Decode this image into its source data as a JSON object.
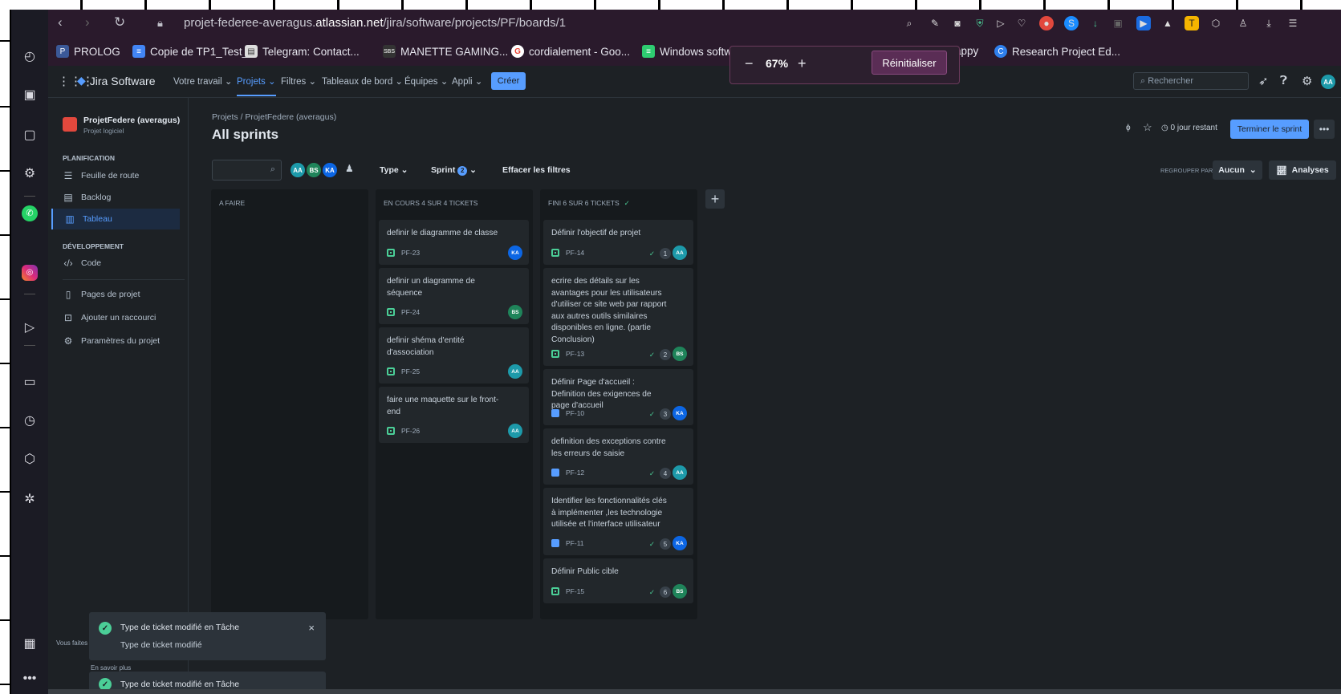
{
  "browser": {
    "url_prefix": "projet-federee-averagus.",
    "url_domain": "atlassian.net",
    "url_path": "/jira/software/projects/PF/boards/1",
    "bookmarks": [
      {
        "label": "PROLOG",
        "icon": "prolog-icon",
        "color": "#3b5998"
      },
      {
        "label": "Copie de TP1_Test_...",
        "icon": "docs-icon",
        "color": "#4285f4"
      },
      {
        "label": "Telegram: Contact...",
        "icon": "file-icon",
        "color": "#dddddd"
      },
      {
        "label": "MANETTE GAMING...",
        "icon": "sbs-icon",
        "color": "#333333"
      },
      {
        "label": "cordialement - Goo...",
        "icon": "google-icon",
        "color": "#ffffff"
      },
      {
        "label": "Windows softw",
        "icon": "windows-icon",
        "color": "#2ecc71"
      },
      {
        "label": "appy",
        "icon": "appy-icon",
        "color": "#2a1a2c"
      },
      {
        "label": "Research Project Ed...",
        "icon": "research-icon",
        "color": "#2f80ed"
      }
    ],
    "zoom": {
      "value": "67%",
      "minus": "−",
      "plus": "+",
      "reset": "Réinitialiser"
    }
  },
  "jira": {
    "product": "Jira Software",
    "nav": [
      "Votre travail",
      "Projets",
      "Filtres",
      "Tableaux de bord",
      "Équipes",
      "Appli"
    ],
    "create": "Créer",
    "search_placeholder": "Rechercher",
    "user_initials": "AA"
  },
  "sidebar": {
    "project_name": "ProjetFedere (averagus)",
    "project_type": "Projet logiciel",
    "planning_header": "PLANIFICATION",
    "planning_items": [
      "Feuille de route",
      "Backlog",
      "Tableau"
    ],
    "dev_header": "DÉVELOPPEMENT",
    "dev_items": [
      "Code"
    ],
    "other_items": [
      "Pages de projet",
      "Ajouter un raccourci",
      "Paramètres du projet"
    ]
  },
  "board": {
    "breadcrumb": "Projets  /  ProjetFedere (averagus)",
    "title": "All sprints",
    "days_left": "0 jour restant",
    "end_sprint": "Terminer le sprint",
    "more": "•••",
    "filters": {
      "avatars": [
        {
          "initials": "AA",
          "color": "#1d9aaa"
        },
        {
          "initials": "BS",
          "color": "#1f845a"
        },
        {
          "initials": "KA",
          "color": "#0c66e4"
        }
      ],
      "type": "Type",
      "sprint": "Sprint",
      "sprint_count": "2",
      "clear": "Effacer les filtres",
      "group_by_label": "REGROUPER PAR",
      "group_by_value": "Aucun",
      "insights": "Analyses"
    },
    "columns": [
      {
        "title": "A FAIRE",
        "done": false,
        "cards": []
      },
      {
        "title": "EN COURS 4 SUR 4 TICKETS",
        "done": false,
        "cards": [
          {
            "title": "definir le diagramme de classe",
            "key": "PF-23",
            "type": "story",
            "assignee": "KA",
            "color": "#0c66e4"
          },
          {
            "title": "definir un diagramme de séquence",
            "key": "PF-24",
            "type": "story",
            "assignee": "BS",
            "color": "#1f845a"
          },
          {
            "title": "definir shéma d'entité d'association",
            "key": "PF-25",
            "type": "story",
            "assignee": "AA",
            "color": "#1d9aaa"
          },
          {
            "title": "faire une maquette sur le front-end",
            "key": "PF-26",
            "type": "story",
            "assignee": "AA",
            "color": "#1d9aaa"
          }
        ]
      },
      {
        "title": "FINI 6 SUR 6 TICKETS",
        "done": true,
        "cards": [
          {
            "title": "Définir l'objectif de projet",
            "key": "PF-14",
            "type": "story",
            "num": "1",
            "assignee": "AA",
            "color": "#1d9aaa"
          },
          {
            "title": "ecrire des détails sur les avantages pour les utilisateurs d'utiliser ce site web par rapport aux autres outils similaires disponibles en ligne. (partie Conclusion)",
            "key": "PF-13",
            "type": "story",
            "num": "2",
            "assignee": "BS",
            "color": "#1f845a"
          },
          {
            "title": "Définir Page d'accueil : Definition des exigences de page d'accueil",
            "key": "PF-10",
            "type": "task",
            "num": "3",
            "assignee": "KA",
            "color": "#0c66e4"
          },
          {
            "title": "definition des exceptions contre les erreurs de saisie",
            "key": "PF-12",
            "type": "task",
            "num": "4",
            "assignee": "AA",
            "color": "#1d9aaa"
          },
          {
            "title": "Identifier les fonctionnalités clés à implémenter ,les technologie utilisée et l'interface utilisateur",
            "key": "PF-11",
            "type": "task",
            "num": "5",
            "assignee": "KA",
            "color": "#0c66e4"
          },
          {
            "title": "Définir Public cible",
            "key": "PF-15",
            "type": "story",
            "num": "6",
            "assignee": "BS",
            "color": "#1f845a"
          }
        ]
      }
    ]
  },
  "toasts": [
    {
      "title": "Type de ticket modifié en Tâche",
      "body": "Type de ticket modifié",
      "close": "×"
    },
    {
      "title": "Type de ticket modifié en Tâche"
    }
  ],
  "side_note": "Vous faites",
  "learn_more": "En savoir plus"
}
